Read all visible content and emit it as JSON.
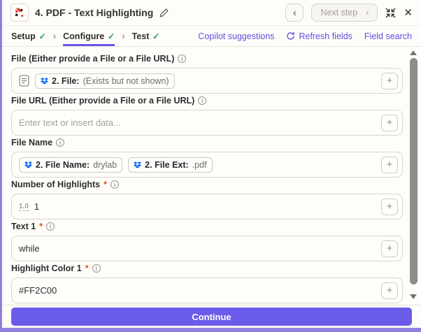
{
  "header": {
    "step_title": "4. PDF - Text Highlighting",
    "next_step_label": "Next step"
  },
  "tabs": {
    "items": [
      {
        "label": "Setup"
      },
      {
        "label": "Configure"
      },
      {
        "label": "Test"
      }
    ],
    "actions": [
      {
        "label": "Copilot suggestions"
      },
      {
        "label": "Refresh fields"
      },
      {
        "label": "Field search"
      }
    ]
  },
  "fields": [
    {
      "label": "File (Either provide a File or a File URL)",
      "tokens": [
        {
          "prefix": "2. File:",
          "value": "(Exists but not shown)"
        }
      ]
    },
    {
      "label": "File URL (Either provide a File or a File URL)",
      "placeholder": "Enter text or insert data..."
    },
    {
      "label": "File Name",
      "tokens": [
        {
          "prefix": "2. File Name:",
          "value": "drylab"
        },
        {
          "prefix": "2. File Ext:",
          "value": ".pdf"
        }
      ]
    },
    {
      "label": "Number of Highlights",
      "required_mark": "*",
      "type_indicator": "1.0",
      "value": "1"
    },
    {
      "label": "Text 1",
      "required_mark": "*",
      "value": "while"
    },
    {
      "label": "Highlight Color 1",
      "required_mark": "*",
      "value": "#FF2C00"
    }
  ],
  "ui": {
    "plus": "+",
    "prev_chevron": "‹",
    "next_chevron": "›",
    "tab_sep": "›",
    "check": "✓",
    "close": "✕",
    "info": "i"
  },
  "footer": {
    "continue_label": "Continue"
  },
  "colors": {
    "accent": "#6357e8",
    "continue_button": "#6a5ce9",
    "dropbox_blue": "#0062ff",
    "check_green": "#1e9e4e",
    "required_red": "#e05226",
    "background_cream": "#fffdf9",
    "highlight_color_value": "#FF2C00"
  }
}
